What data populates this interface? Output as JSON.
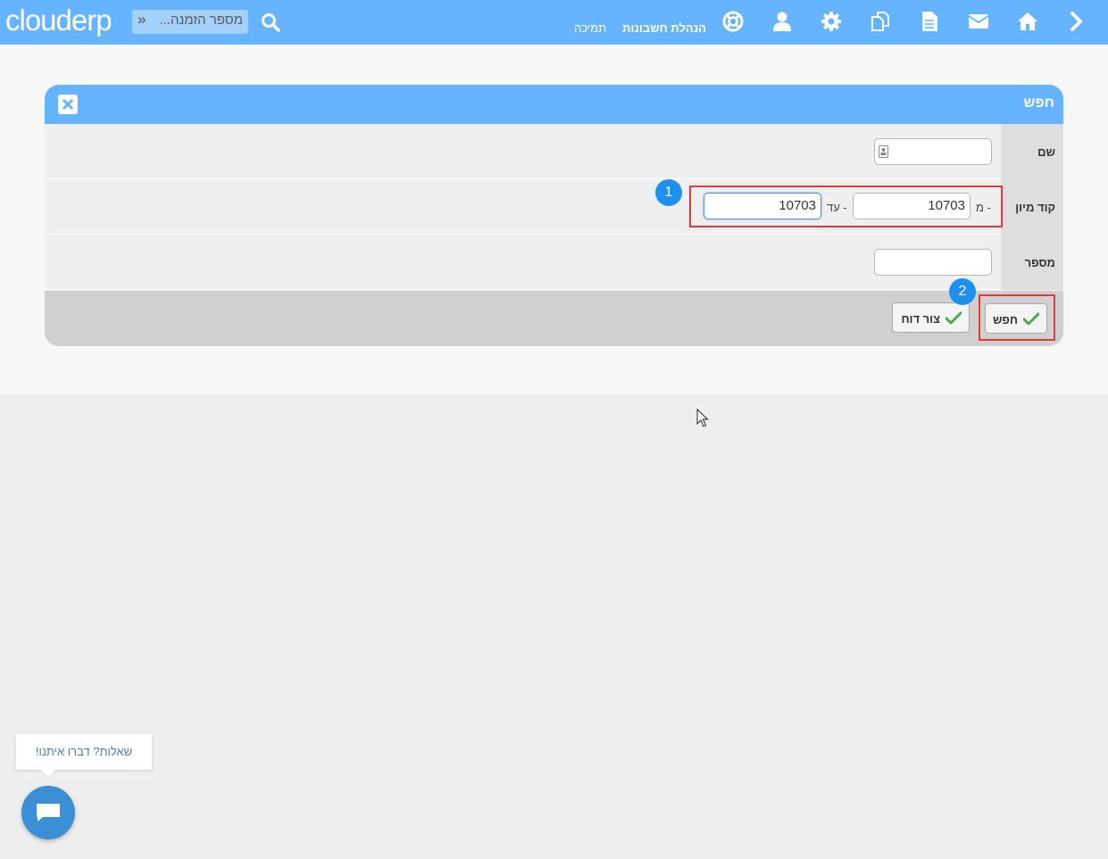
{
  "topbar": {
    "logo": "clouderp",
    "search_placeholder": "מספר הזמנה...",
    "nav_links": {
      "accounting": "הנהלת חשבונות",
      "support": "תמיכה"
    },
    "icons": [
      "search-icon",
      "lifebuoy-icon",
      "user-icon",
      "gear-icon",
      "copy-icon",
      "document-icon",
      "mail-icon",
      "home-icon",
      "chevron-right-icon"
    ],
    "accent": "#66b4ff"
  },
  "panel": {
    "title": "חפש",
    "rows": {
      "name": {
        "label": "שם",
        "value": ""
      },
      "sort_code": {
        "label": "קוד מיון",
        "from_label": "מ -",
        "from_value": "10703",
        "to_label": "עד -",
        "to_value": "10703"
      },
      "number": {
        "label": "מספר",
        "value": ""
      }
    },
    "buttons": {
      "search": "חפש",
      "create_report": "צור דוח"
    }
  },
  "annotations": {
    "step1": "1",
    "step2": "2",
    "highlight_color": "#e03a3a"
  },
  "chat": {
    "prompt": "שאלות? דברו איתנו!"
  }
}
